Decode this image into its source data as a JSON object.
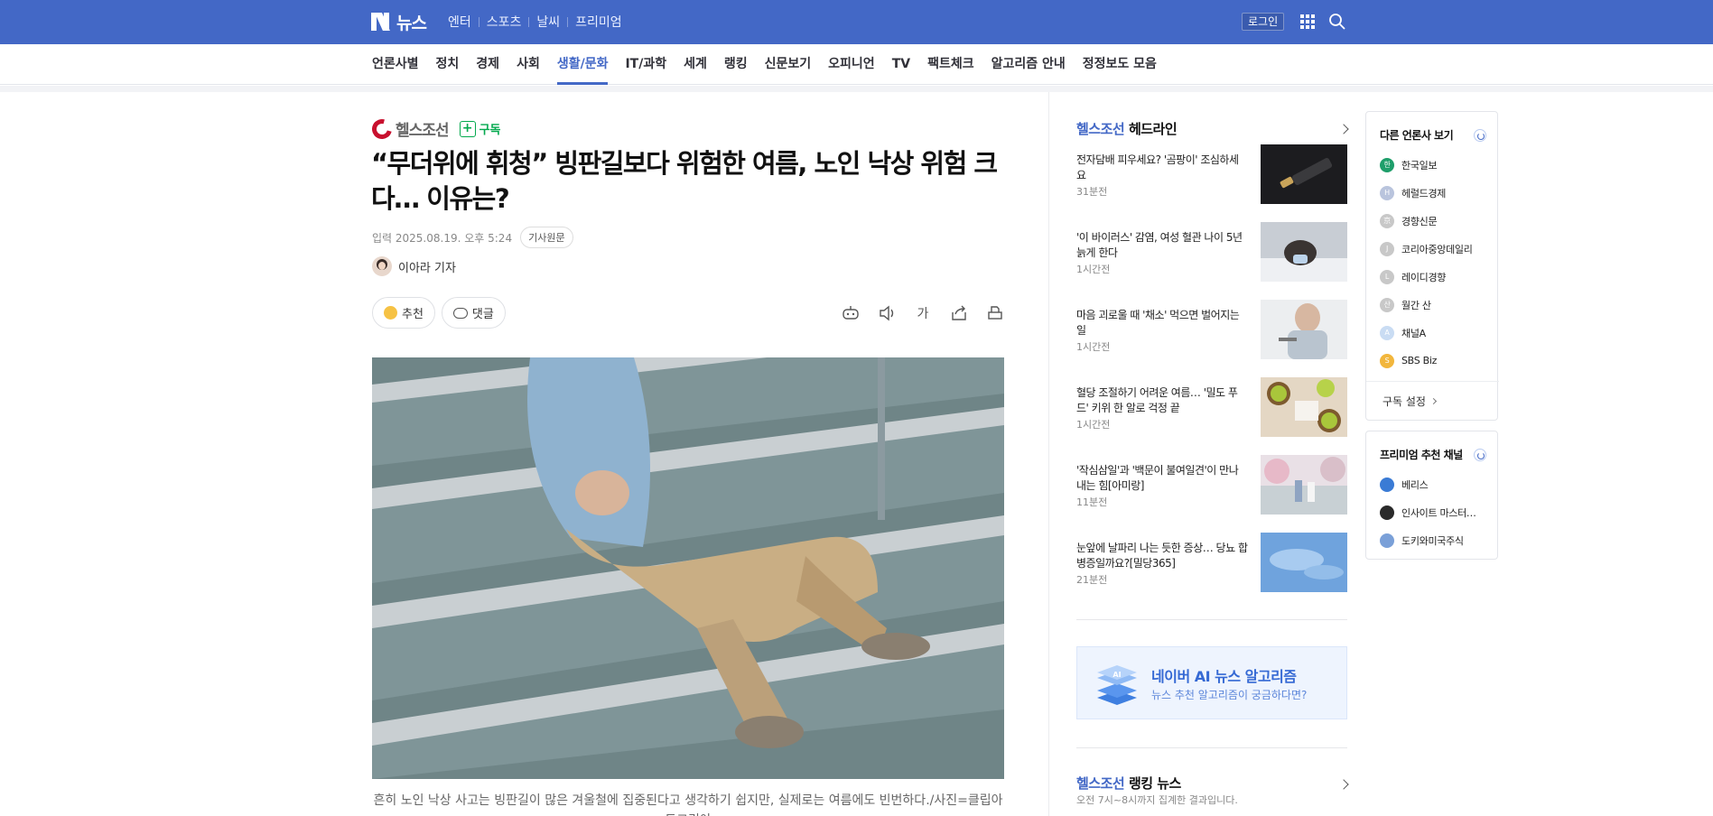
{
  "header": {
    "logo_text": "뉴스",
    "nav": [
      "엔터",
      "스포츠",
      "날씨",
      "프리미엄"
    ],
    "login_label": "로그인",
    "colors": {
      "bar": "#4368c6"
    }
  },
  "categories": [
    "언론사별",
    "정치",
    "경제",
    "사회",
    "생활/문화",
    "IT/과학",
    "세계",
    "랭킹",
    "신문보기",
    "오피니언",
    "TV",
    "팩트체크",
    "알고리즘 안내",
    "정정보도 모음"
  ],
  "active_category": "생활/문화",
  "article": {
    "press_name": "헬스조선",
    "subscribe_label": "구독",
    "headline": "“무더위에 휘청” 빙판길보다 위험한 여름, 노인 낙상 위험 크다… 이유는?",
    "date": "입력 2025.08.19. 오후 5:24",
    "original_button": "기사원문",
    "reporter": "이아라 기자",
    "recommend_label": "추천",
    "comment_label": "댓글",
    "font_tool_label": "가",
    "caption": "흔히 노인 낙상 사고는 빙판길이 많은 겨울철에 집중된다고 생각하기 쉽지만, 실제로는 여름에도 빈번하다./사진=클립아트코리아"
  },
  "headlines": {
    "press": "헬스조선",
    "title_suffix": "헤드라인",
    "items": [
      {
        "title": "전자담배 피우세요? '곰팡이' 조심하세요",
        "time": "31분전"
      },
      {
        "title": "'이 바이러스' 감염, 여성 혈관 나이 5년 늙게 한다",
        "time": "1시간전"
      },
      {
        "title": "마음 괴로울 때 '채소' 먹으면 벌어지는 일",
        "time": "1시간전"
      },
      {
        "title": "혈당 조절하기 어려운 여름… '밀도 푸드' 키위 한 알로 걱정 끝",
        "time": "1시간전"
      },
      {
        "title": "'작심삼일'과 '백문이 불여일견'이 만나 내는 힘[아미랑]",
        "time": "11분전"
      },
      {
        "title": "눈앞에 날파리 나는 듯한 증상… 당뇨 합병증일까요?[밀당365]",
        "time": "21분전"
      }
    ]
  },
  "ai_banner": {
    "title": "네이버 AI 뉴스 알고리즘",
    "subtitle": "뉴스 추천 알고리즘이 궁금하다면?",
    "icon_text": "AI"
  },
  "ranking": {
    "press": "헬스조선",
    "title_suffix": "랭킹 뉴스",
    "subtitle": "오전 7시~8시까지 집계한 결과입니다."
  },
  "other_press": {
    "title": "다른 언론사 보기",
    "items": [
      {
        "name": "한국일보",
        "icon": "한",
        "color": "#1e9e6a"
      },
      {
        "name": "헤럴드경제",
        "icon": "H",
        "color": "#b9c4dd"
      },
      {
        "name": "경향신문",
        "icon": "京",
        "color": "#c8c8c8"
      },
      {
        "name": "코리아중앙데일리",
        "icon": "J",
        "color": "#c8c8c8"
      },
      {
        "name": "레이디경향",
        "icon": "L",
        "color": "#c8c8c8"
      },
      {
        "name": "월간 산",
        "icon": "산",
        "color": "#c8c8c8"
      },
      {
        "name": "채널A",
        "icon": "A",
        "color": "#c9dcf3"
      },
      {
        "name": "SBS Biz",
        "icon": "S",
        "color": "#f2b63c"
      }
    ],
    "setting_label": "구독 설정"
  },
  "premium": {
    "title": "프리미엄 추천 채널",
    "items": [
      {
        "name": "베리스",
        "color": "#3a7bd5"
      },
      {
        "name": "인사이트 마스터…",
        "color": "#2a2a2a"
      },
      {
        "name": "도키와미국주식",
        "color": "#7aa0d8"
      }
    ]
  }
}
